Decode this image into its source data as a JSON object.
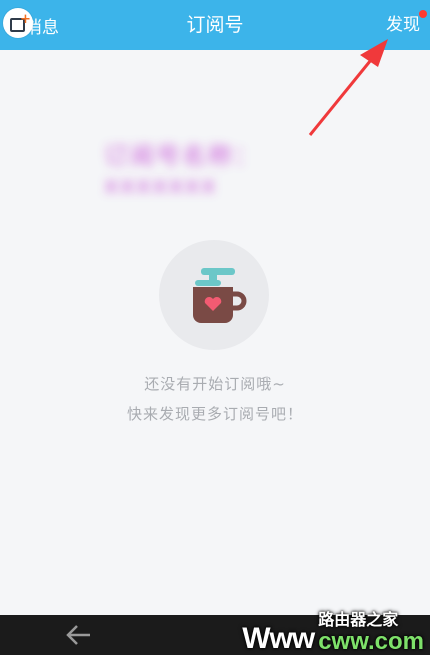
{
  "header": {
    "back_label": "消息",
    "title": "订阅号",
    "discover_label": "发现",
    "accent_color": "#3cb4ea",
    "dot_color": "#ff3b30"
  },
  "account": {
    "blurred_name": "订阅号名称：xxxxxxx"
  },
  "empty_state": {
    "icon": "coffee-cup-icon",
    "line1": "还没有开始订阅哦~",
    "line2": "快来发现更多订阅号吧！"
  },
  "navigation": {
    "back_icon": "back-arrow-icon"
  },
  "watermark": {
    "www": "Www",
    "site_top": "路由器之家",
    "site_bottom": "cww.com"
  }
}
